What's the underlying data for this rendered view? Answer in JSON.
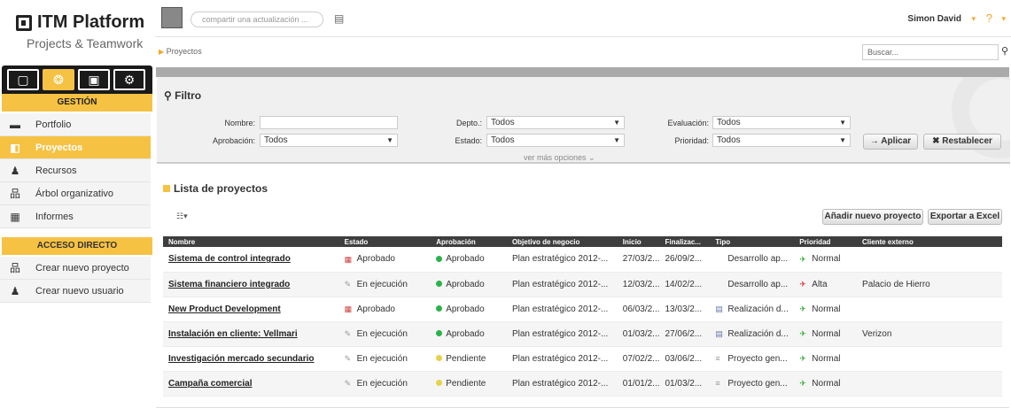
{
  "logo": {
    "name": "ITM Platform",
    "subtitle": "Projects & Teamwork"
  },
  "topbar": {
    "share_placeholder": "compartir una actualización ...",
    "user": "Simon David",
    "user_caret": "▾",
    "help": "?",
    "help_caret": "▾"
  },
  "breadcrumb": "Proyectos",
  "search": {
    "placeholder": "Buscar..."
  },
  "sidebar": {
    "section_gestion": "GESTIÓN",
    "items": [
      {
        "label": "Portfolio",
        "icon": "briefcase-icon"
      },
      {
        "label": "Proyectos",
        "icon": "projects-icon"
      },
      {
        "label": "Recursos",
        "icon": "user-icon"
      },
      {
        "label": "Árbol organizativo",
        "icon": "org-tree-icon"
      },
      {
        "label": "Informes",
        "icon": "reports-icon"
      }
    ],
    "section_acceso": "ACCESO DIRECTO",
    "shortcuts": [
      {
        "label": "Crear nuevo proyecto",
        "icon": "new-project-icon"
      },
      {
        "label": "Crear nuevo usuario",
        "icon": "new-user-icon"
      }
    ]
  },
  "filter": {
    "title": "Filtro",
    "nombre_label": "Nombre:",
    "nombre_value": "",
    "aprobacion_label": "Aprobación:",
    "aprobacion_value": "Todos",
    "depto_label": "Depto.:",
    "depto_value": "Todos",
    "estado_label": "Estado:",
    "estado_value": "Todos",
    "evaluacion_label": "Evaluación:",
    "evaluacion_value": "Todos",
    "prioridad_label": "Prioridad:",
    "prioridad_value": "Todos",
    "ver_mas": "ver más opciones",
    "aplicar": "→ Aplicar",
    "restablecer": "✖ Restablecer"
  },
  "list": {
    "title": "Lista de proyectos",
    "add_button": "Añadir nuevo proyecto",
    "export_button": "Exportar a Excel",
    "columns": [
      "Nombre",
      "Estado",
      "Aprobación",
      "Objetivo de negocio",
      "Inicio",
      "Finalizac...",
      "Tipo",
      "Prioridad",
      "Cliente externo"
    ],
    "rows": [
      {
        "name": "Sistema de control integrado",
        "estado": "Aprobado",
        "aprobacion": "Aprobado",
        "objetivo": "Plan estratégico 2012-...",
        "inicio": "27/03/2...",
        "fin": "26/09/2...",
        "tipo": "Desarrollo ap...",
        "prioridad": "Normal",
        "cliente": ""
      },
      {
        "name": "Sistema financiero integrado",
        "estado": "En ejecución",
        "aprobacion": "Aprobado",
        "objetivo": "Plan estratégico 2012-...",
        "inicio": "12/03/2...",
        "fin": "14/02/2...",
        "tipo": "Desarrollo ap...",
        "prioridad": "Alta",
        "cliente": "Palacio de Hierro"
      },
      {
        "name": "New Product Development",
        "estado": "Aprobado",
        "aprobacion": "Aprobado",
        "objetivo": "Plan estratégico 2012-...",
        "inicio": "06/03/2...",
        "fin": "13/03/2...",
        "tipo": "Realización d...",
        "prioridad": "Normal",
        "cliente": ""
      },
      {
        "name": "Instalación en cliente: Vellmari",
        "estado": "En ejecución",
        "aprobacion": "Aprobado",
        "objetivo": "Plan estratégico 2012-...",
        "inicio": "01/03/2...",
        "fin": "27/06/2...",
        "tipo": "Realización d...",
        "prioridad": "Normal",
        "cliente": "Verizon"
      },
      {
        "name": "Investigación mercado secundario",
        "estado": "En ejecución",
        "aprobacion": "Pendiente",
        "objetivo": "Plan estratégico 2012-...",
        "inicio": "07/02/2...",
        "fin": "03/06/2...",
        "tipo": "Proyecto gen...",
        "prioridad": "Normal",
        "cliente": ""
      },
      {
        "name": "Campaña comercial",
        "estado": "En ejecución",
        "aprobacion": "Pendiente",
        "objetivo": "Plan estratégico 2012-...",
        "inicio": "01/01/2...",
        "fin": "01/03/2...",
        "tipo": "Proyecto gen...",
        "prioridad": "Normal",
        "cliente": ""
      }
    ]
  },
  "colors": {
    "accent": "#f6c244",
    "approved_dot": "#2bb24c",
    "pending_dot": "#e6d24a",
    "header_bg": "#3e3e3e"
  }
}
